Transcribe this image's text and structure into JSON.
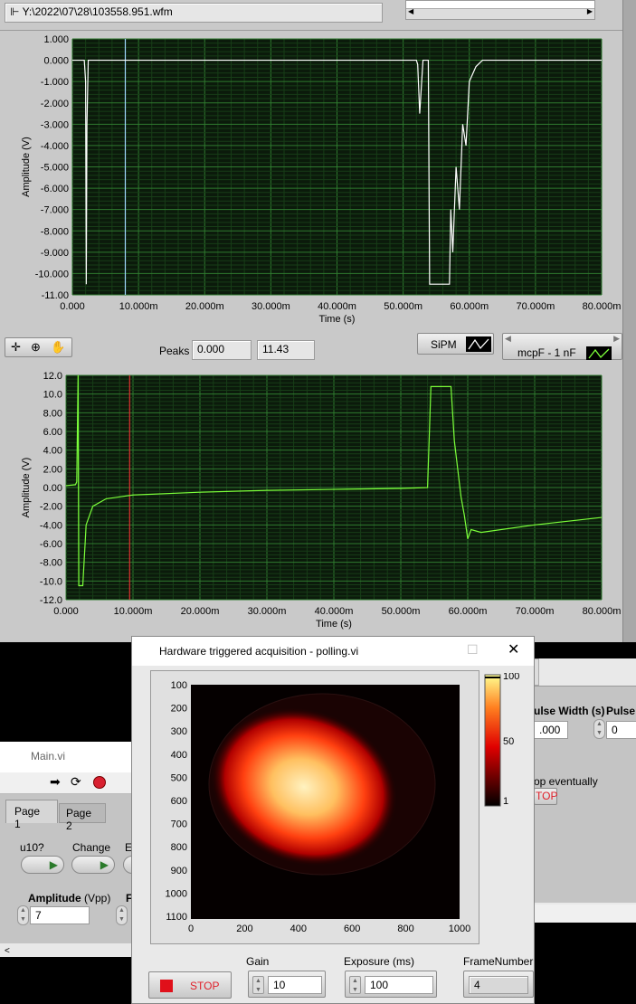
{
  "file_path": "Y:\\2022\\07\\28\\103558.951.wfm",
  "toolbar": {
    "peaks_label": "Peaks",
    "peak1": "0.000",
    "peak2": "11.43",
    "legend1": "SiPM",
    "legend2": "mcpF - 1 nF"
  },
  "colors": {
    "panel": "#c9c9c9",
    "plot_bg": "#0b1a0b",
    "grid_major": "#2f7a2f",
    "grid_minor": "#173d17",
    "trace1": "#ffffff",
    "trace2": "#7cff3a",
    "cursor1": "#9fd8ff",
    "cursor2": "#e03030"
  },
  "chart_data": [
    {
      "type": "line",
      "title": "",
      "xlabel": "Time (s)",
      "ylabel": "Amplitude (V)",
      "xlim": [
        0,
        0.08
      ],
      "ylim": [
        -11,
        1
      ],
      "xticks": [
        "0.000",
        "10.000m",
        "20.000m",
        "30.000m",
        "40.000m",
        "50.000m",
        "60.000m",
        "70.000m",
        "80.000m"
      ],
      "yticks": [
        "1.000",
        "0.000",
        "-1.000",
        "-2.000",
        "-3.000",
        "-4.000",
        "-5.000",
        "-6.000",
        "-7.000",
        "-8.000",
        "-9.000",
        "-10.000",
        "-11.00"
      ],
      "cursor_x": 0.008,
      "series": [
        {
          "name": "SiPM",
          "x": [
            0,
            0.0018,
            0.002,
            0.0021,
            0.0022,
            0.0024,
            0.052,
            0.0522,
            0.0525,
            0.053,
            0.0538,
            0.054,
            0.0545,
            0.057,
            0.0572,
            0.0575,
            0.058,
            0.0585,
            0.059,
            0.0595,
            0.06,
            0.061,
            0.062,
            0.08
          ],
          "y": [
            0,
            0,
            -1,
            -10.5,
            -3,
            0,
            0,
            -0.2,
            -2.5,
            0,
            0,
            -10.5,
            -10.5,
            -10.5,
            -7,
            -9,
            -5,
            -7,
            -3,
            -4,
            -1,
            -0.3,
            0,
            0
          ]
        }
      ]
    },
    {
      "type": "line",
      "title": "",
      "xlabel": "Time (s)",
      "ylabel": "Amplitude (V)",
      "xlim": [
        0,
        0.08
      ],
      "ylim": [
        -12,
        12
      ],
      "xticks": [
        "0.000",
        "10.000m",
        "20.000m",
        "30.000m",
        "40.000m",
        "50.000m",
        "60.000m",
        "70.000m",
        "80.000m"
      ],
      "yticks": [
        "12.0",
        "10.0",
        "8.00",
        "6.00",
        "4.00",
        "2.00",
        "0.00",
        "-2.00",
        "-4.00",
        "-6.00",
        "-8.00",
        "-10.0",
        "-12.0"
      ],
      "cursor_x": 0.0095,
      "series": [
        {
          "name": "mcpF - 1 nF",
          "x": [
            0,
            0.0014,
            0.0016,
            0.0018,
            0.0019,
            0.002,
            0.0025,
            0.003,
            0.004,
            0.006,
            0.01,
            0.02,
            0.03,
            0.04,
            0.05,
            0.054,
            0.0545,
            0.0575,
            0.058,
            0.0585,
            0.059,
            0.0595,
            0.06,
            0.0605,
            0.062,
            0.07,
            0.08
          ],
          "y": [
            0.2,
            0.3,
            0.6,
            12,
            -10.5,
            -10.5,
            -10.5,
            -4,
            -2,
            -1.2,
            -0.8,
            -0.5,
            -0.3,
            -0.2,
            -0.1,
            0,
            10.8,
            10.8,
            5,
            2,
            -1,
            -3,
            -5.5,
            -4.5,
            -4.8,
            -4,
            -3.2
          ]
        }
      ]
    },
    {
      "type": "heatmap",
      "title": "Hardware triggered acquisition - polling.vi",
      "xticks": [
        "0",
        "200",
        "400",
        "600",
        "800",
        "1000"
      ],
      "yticks": [
        "100",
        "200",
        "300",
        "400",
        "500",
        "600",
        "700",
        "800",
        "900",
        "1000",
        "1100"
      ],
      "scale_ticks": [
        "100",
        "50",
        "1"
      ],
      "zlim": [
        1,
        100
      ]
    }
  ],
  "popup": {
    "title": "Hardware triggered acquisition - polling.vi",
    "stop": "STOP",
    "gain_label": "Gain",
    "gain": "10",
    "exposure_label": "Exposure (ms)",
    "exposure": "100",
    "frame_label": "FrameNumber",
    "frame": "4"
  },
  "main": {
    "title": "Main.vi",
    "tabs": [
      "Page 1",
      "Page 2"
    ],
    "btn1": "u10?",
    "btn2": "Change",
    "btn3": "E",
    "amp_label": "Amplitude",
    "amp_unit": " (Vpp)",
    "amp": "7",
    "f_label": "F"
  },
  "rightwin": {
    "pw_label": "ulse Width (s)",
    "pw": ".000",
    "pb_label": "Pulse I",
    "pb": "0",
    "note": "op eventually",
    "stop": "TOP"
  }
}
